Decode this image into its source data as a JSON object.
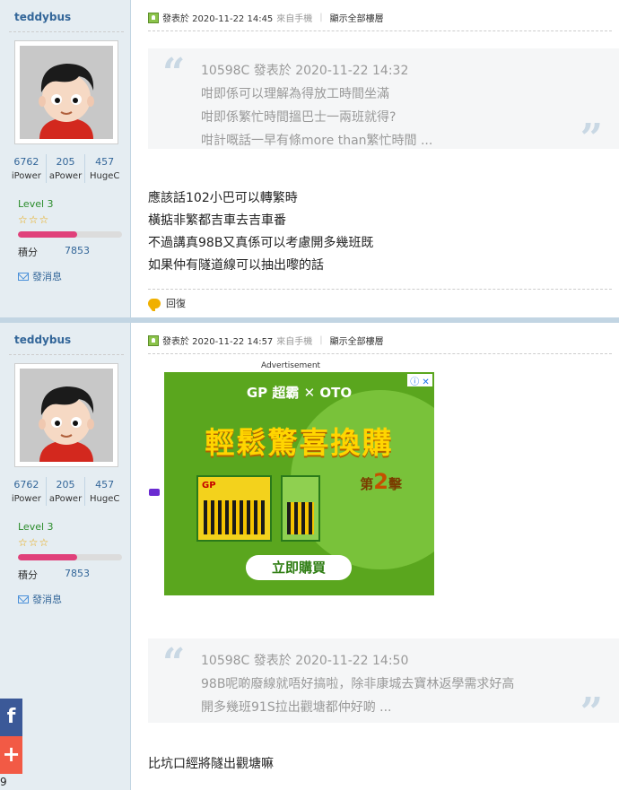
{
  "posts": [
    {
      "author": "teddybus",
      "stats": [
        {
          "num": "6762",
          "label": "iPower"
        },
        {
          "num": "205",
          "label": "aPower"
        },
        {
          "num": "457",
          "label": "HugeC"
        }
      ],
      "level": "Level 3",
      "stars": "☆☆☆",
      "credit_progress": 0.57,
      "score_label": "積分",
      "score_value": "7853",
      "send_message": "發消息",
      "posted_at": "發表於 2020-11-22 14:45",
      "posted_from": "來自手機",
      "show_all": "顯示全部樓層",
      "quote": {
        "header": "10598C 發表於 2020-11-22 14:32",
        "lines": [
          "咁即係可以理解為得放工時間坐滿",
          "咁即係繁忙時間搵巴士一兩班就得?",
          "咁計嘅話一早有條more than繁忙時間 ..."
        ]
      },
      "body": [
        "應該話102小巴可以轉繁時",
        "橫掂非繁都吉車去吉車番",
        "不過講真98B又真係可以考慮開多幾班既",
        "如果仲有隧道線可以抽出嚟的話"
      ],
      "reply": "回復"
    },
    {
      "author": "teddybus",
      "stats": [
        {
          "num": "6762",
          "label": "iPower"
        },
        {
          "num": "205",
          "label": "aPower"
        },
        {
          "num": "457",
          "label": "HugeC"
        }
      ],
      "level": "Level 3",
      "stars": "☆☆☆",
      "credit_progress": 0.57,
      "score_label": "積分",
      "score_value": "7853",
      "send_message": "發消息",
      "posted_at": "發表於 2020-11-22 14:57",
      "posted_from": "來自手機",
      "show_all": "顯示全部樓層",
      "ad": {
        "label": "Advertisement",
        "brand": "GP 超霸 ✕ OTO",
        "headline": "輕鬆驚喜換購",
        "tier_prefix": "第",
        "tier_num": "2",
        "tier_suffix": "擊",
        "button": "立即購買",
        "close_icons": "ⓘ ✕"
      },
      "quote": {
        "header": "10598C 發表於 2020-11-22 14:50",
        "lines": [
          "98B呢啲廢線就唔好搞啦，除非康城去寶林返學需求好高",
          "開多幾班91S拉出觀塘都仲好啲 ..."
        ]
      },
      "body": [
        "比坑口經將隧出觀塘嘛"
      ]
    }
  ],
  "share": {
    "facebook": "f",
    "plus": "+",
    "count": "9"
  },
  "colors": {
    "sidebar_bg": "#e5edf2",
    "link": "#336699",
    "level_green": "#2b8c2b",
    "credit_pink": "#e0407a",
    "ad_green": "#5aa61e"
  }
}
